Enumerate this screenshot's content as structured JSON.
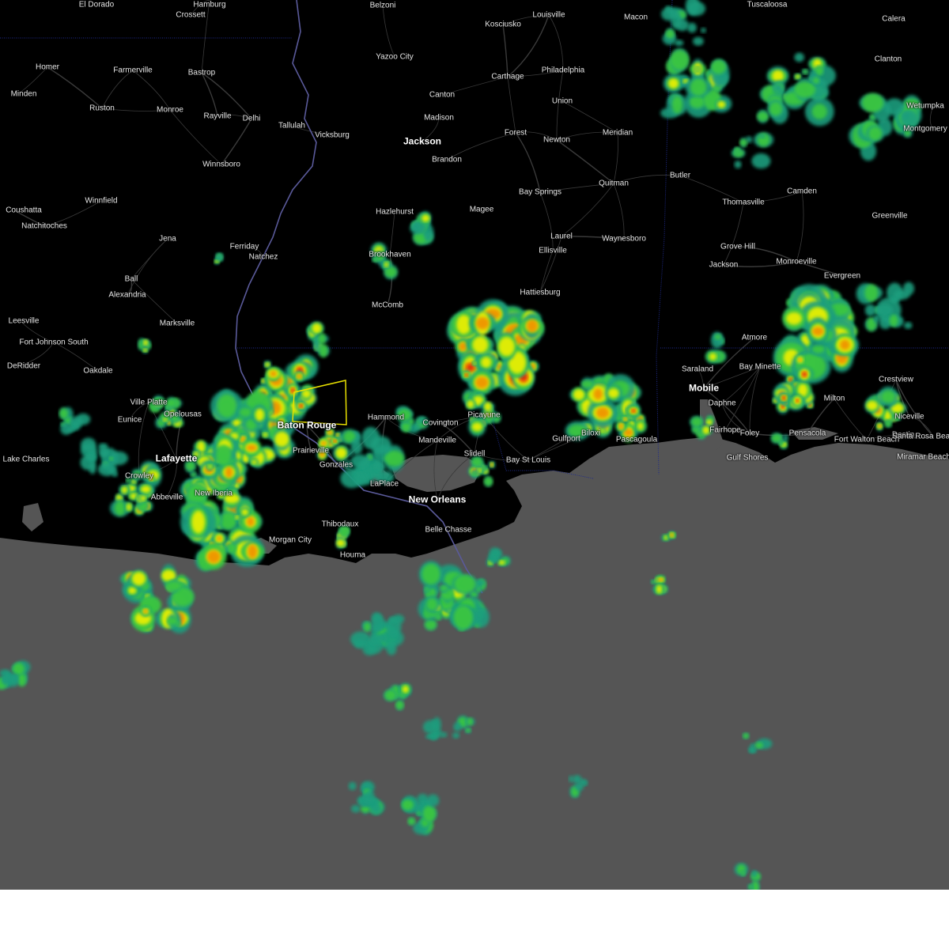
{
  "map": {
    "colors": {
      "land": "#000000",
      "water": "#555555",
      "roads": "#3a3a3a",
      "state_border": "#1e2a8c",
      "river": "#5a5a9a",
      "warning_polygon": "#e8e000",
      "radar_light": "#1e9e7e",
      "radar_green": "#3cc83c",
      "radar_yellow": "#f0f000",
      "radar_orange": "#f09000",
      "radar_red": "#e02010"
    },
    "places": [
      {
        "name": "El Dorado",
        "major": false
      },
      {
        "name": "Hamburg",
        "major": false
      },
      {
        "name": "Crossett",
        "major": false
      },
      {
        "name": "Belzoni",
        "major": false
      },
      {
        "name": "Kosciusko",
        "major": false
      },
      {
        "name": "Louisville",
        "major": false
      },
      {
        "name": "Macon",
        "major": false
      },
      {
        "name": "Tuscaloosa",
        "major": false
      },
      {
        "name": "Calera",
        "major": false
      },
      {
        "name": "Yazoo City",
        "major": false
      },
      {
        "name": "Homer",
        "major": false
      },
      {
        "name": "Farmerville",
        "major": false
      },
      {
        "name": "Bastrop",
        "major": false
      },
      {
        "name": "Carthage",
        "major": false
      },
      {
        "name": "Philadelphia",
        "major": false
      },
      {
        "name": "Clanton",
        "major": false
      },
      {
        "name": "Minden",
        "major": false
      },
      {
        "name": "Canton",
        "major": false
      },
      {
        "name": "Union",
        "major": false
      },
      {
        "name": "Ruston",
        "major": false
      },
      {
        "name": "Monroe",
        "major": false
      },
      {
        "name": "Madison",
        "major": false
      },
      {
        "name": "Wetumpka",
        "major": false
      },
      {
        "name": "Rayville",
        "major": false
      },
      {
        "name": "Delhi",
        "major": false
      },
      {
        "name": "Tallulah",
        "major": false
      },
      {
        "name": "Vicksburg",
        "major": false
      },
      {
        "name": "Jackson",
        "major": true
      },
      {
        "name": "Forest",
        "major": false
      },
      {
        "name": "Newton",
        "major": false
      },
      {
        "name": "Meridian",
        "major": false
      },
      {
        "name": "Montgomery",
        "major": false
      },
      {
        "name": "Brandon",
        "major": false
      },
      {
        "name": "Winnsboro",
        "major": false
      },
      {
        "name": "Butler",
        "major": false
      },
      {
        "name": "Quitman",
        "major": false
      },
      {
        "name": "Bay Springs",
        "major": false
      },
      {
        "name": "Camden",
        "major": false
      },
      {
        "name": "Winnfield",
        "major": false
      },
      {
        "name": "Thomasville",
        "major": false
      },
      {
        "name": "Coushatta",
        "major": false
      },
      {
        "name": "Hazlehurst",
        "major": false
      },
      {
        "name": "Magee",
        "major": false
      },
      {
        "name": "Greenville",
        "major": false
      },
      {
        "name": "Natchitoches",
        "major": false
      },
      {
        "name": "Jena",
        "major": false
      },
      {
        "name": "Laurel",
        "major": false
      },
      {
        "name": "Waynesboro",
        "major": false
      },
      {
        "name": "Ferriday",
        "major": false
      },
      {
        "name": "Natchez",
        "major": false
      },
      {
        "name": "Brookhaven",
        "major": false
      },
      {
        "name": "Ellisville",
        "major": false
      },
      {
        "name": "Grove Hill",
        "major": false
      },
      {
        "name": "Monroeville",
        "major": false
      },
      {
        "name": "Jackson",
        "major": false
      },
      {
        "name": "Ball",
        "major": false
      },
      {
        "name": "Evergreen",
        "major": false
      },
      {
        "name": "Alexandria",
        "major": false
      },
      {
        "name": "McComb",
        "major": false
      },
      {
        "name": "Hattiesburg",
        "major": false
      },
      {
        "name": "Leesville",
        "major": false
      },
      {
        "name": "Marksville",
        "major": false
      },
      {
        "name": "Fort Johnson South",
        "major": false
      },
      {
        "name": "Atmore",
        "major": false
      },
      {
        "name": "DeRidder",
        "major": false
      },
      {
        "name": "Oakdale",
        "major": false
      },
      {
        "name": "Saraland",
        "major": false
      },
      {
        "name": "Bay Minette",
        "major": false
      },
      {
        "name": "Mobile",
        "major": true
      },
      {
        "name": "Crestview",
        "major": false
      },
      {
        "name": "Ville Platte",
        "major": false
      },
      {
        "name": "Milton",
        "major": false
      },
      {
        "name": "Daphne",
        "major": false
      },
      {
        "name": "Eunice",
        "major": false
      },
      {
        "name": "Opelousas",
        "major": false
      },
      {
        "name": "Hammond",
        "major": false
      },
      {
        "name": "Covington",
        "major": false
      },
      {
        "name": "Picayune",
        "major": false
      },
      {
        "name": "Gulfport",
        "major": false
      },
      {
        "name": "Biloxi",
        "major": false
      },
      {
        "name": "Pascagoula",
        "major": false
      },
      {
        "name": "Niceville",
        "major": false
      },
      {
        "name": "Baton Rouge",
        "major": true
      },
      {
        "name": "Fairhope",
        "major": false
      },
      {
        "name": "Foley",
        "major": false
      },
      {
        "name": "Pensacola",
        "major": false
      },
      {
        "name": "Fort Walton Beach",
        "major": false
      },
      {
        "name": "Destin",
        "major": false
      },
      {
        "name": "Santa Rosa Beach",
        "major": false
      },
      {
        "name": "Mandeville",
        "major": false
      },
      {
        "name": "Lake Charles",
        "major": false
      },
      {
        "name": "Lafayette",
        "major": true
      },
      {
        "name": "Prairieville",
        "major": false
      },
      {
        "name": "Slidell",
        "major": false
      },
      {
        "name": "Bay St Louis",
        "major": false
      },
      {
        "name": "Gulf Shores",
        "major": false
      },
      {
        "name": "Miramar Beach",
        "major": false
      },
      {
        "name": "Crowley",
        "major": false
      },
      {
        "name": "Gonzales",
        "major": false
      },
      {
        "name": "LaPlace",
        "major": false
      },
      {
        "name": "New Orleans",
        "major": true
      },
      {
        "name": "Abbeville",
        "major": false
      },
      {
        "name": "New Iberia",
        "major": false
      },
      {
        "name": "Belle Chasse",
        "major": false
      },
      {
        "name": "Thibodaux",
        "major": false
      },
      {
        "name": "Morgan City",
        "major": false
      },
      {
        "name": "Houma",
        "major": false
      }
    ]
  }
}
